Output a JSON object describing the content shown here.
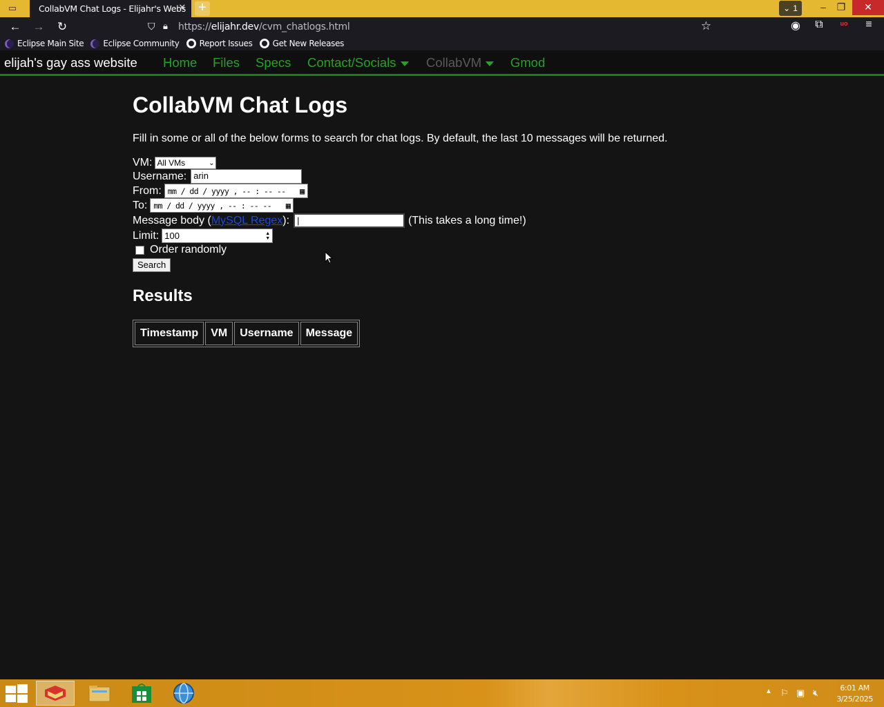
{
  "browser": {
    "tab_title": "CollabVM Chat Logs - Elijahr's Webs",
    "tab_close": "✕",
    "new_tab": "+",
    "tab_count": "1",
    "url_scheme": "https://",
    "url_domain": "elijahr.dev",
    "url_path": "/cvm_chatlogs.html"
  },
  "bookmarks": [
    {
      "label": "Eclipse Main Site",
      "icon": "eclipse-icon"
    },
    {
      "label": "Eclipse Community",
      "icon": "eclipse-icon"
    },
    {
      "label": "Report Issues",
      "icon": "github-icon"
    },
    {
      "label": "Get New Releases",
      "icon": "github-icon"
    }
  ],
  "site": {
    "title": "elijah's gay ass website",
    "nav": [
      {
        "label": "Home"
      },
      {
        "label": "Files"
      },
      {
        "label": "Specs"
      },
      {
        "label": "Contact/Socials"
      },
      {
        "label": "CollabVM"
      },
      {
        "label": "Gmod"
      }
    ]
  },
  "page": {
    "heading": "CollabVM Chat Logs",
    "intro": "Fill in some or all of the below forms to search for chat logs. By default, the last 10 messages will be returned.",
    "form": {
      "vm_label": "VM:",
      "vm_value": "All VMs",
      "username_label": "Username:",
      "username_value": "arin",
      "from_label": "From:",
      "to_label": "To:",
      "datetime_placeholder": "mm / dd / yyyy ,  -- : --  --",
      "message_label_pre": "Message body (",
      "message_link": "MySQL Regex",
      "message_label_post": "):",
      "message_note": "(This takes a long time!)",
      "limit_label": "Limit:",
      "limit_value": "100",
      "order_label": "Order randomly",
      "search_button": "Search"
    },
    "results_heading": "Results",
    "table_headers": [
      "Timestamp",
      "VM",
      "Username",
      "Message"
    ]
  },
  "taskbar": {
    "time": "6:01 AM",
    "date": "3/25/2025"
  },
  "colors": {
    "nav_link": "#25a225",
    "nav_link_disabled": "#5a5a5a",
    "page_bg": "#141414",
    "taskbar": "#d8921a"
  }
}
